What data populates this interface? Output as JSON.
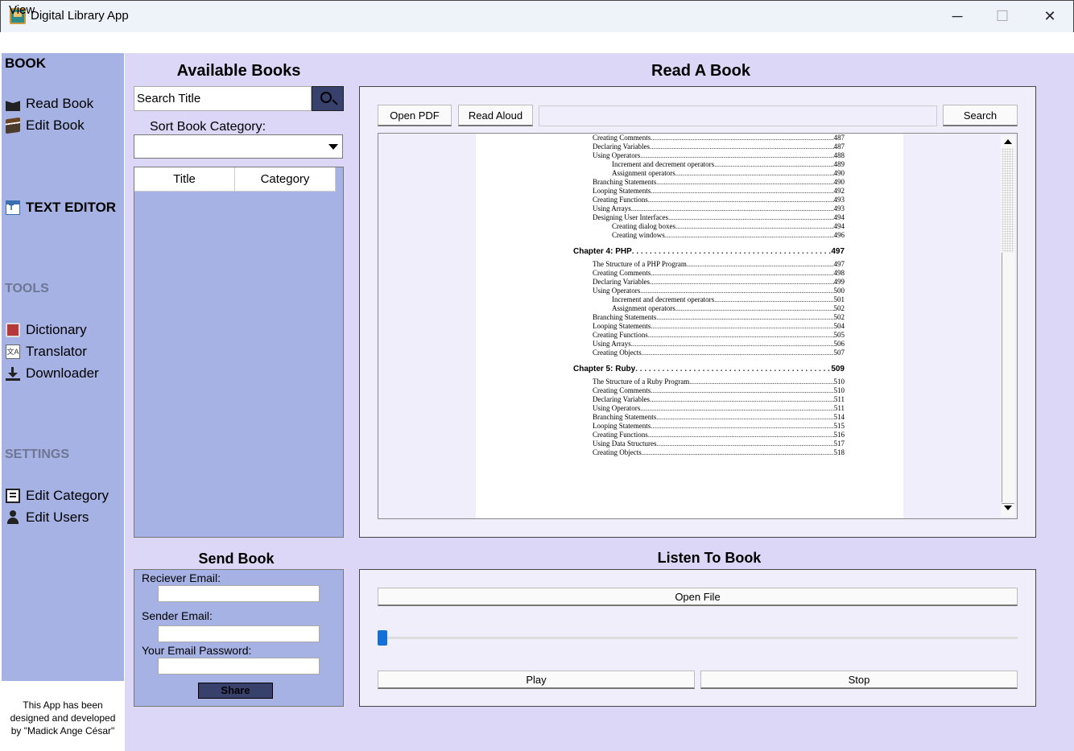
{
  "window": {
    "title": "Digital Library App",
    "minimize": "─",
    "maximize": "☐",
    "close": "✕"
  },
  "menu": {
    "view": "View"
  },
  "sidebar": {
    "book_heading": "BOOK",
    "read_book": "Read Book",
    "edit_book": "Edit Book",
    "text_editor": "TEXT EDITOR",
    "tools_heading": "TOOLS",
    "dictionary": "Dictionary",
    "translator": "Translator",
    "downloader": "Downloader",
    "settings_heading": "SETTINGS",
    "edit_category": "Edit Category",
    "edit_users": "Edit Users",
    "footer_line1": "This App has been",
    "footer_line2": "designed and developed",
    "footer_line3": "by \"Madick Ange César\""
  },
  "available_books": {
    "heading": "Available Books",
    "search_value": "Search Title",
    "sort_label": "Sort Book Category:",
    "sort_value": "",
    "columns": [
      "Title",
      "Category"
    ]
  },
  "reader": {
    "heading": "Read A Book",
    "open_pdf": "Open PDF",
    "read_aloud": "Read Aloud",
    "search_value": "",
    "search_button": "Search",
    "toc": [
      {
        "kind": "item",
        "text": "Creating Comments",
        "page": "487"
      },
      {
        "kind": "item",
        "text": "Declaring Variables",
        "page": "487"
      },
      {
        "kind": "item",
        "text": "Using Operators",
        "page": "488"
      },
      {
        "kind": "sub",
        "text": "Increment and decrement operators",
        "page": "489"
      },
      {
        "kind": "sub",
        "text": "Assignment operators",
        "page": "490"
      },
      {
        "kind": "item",
        "text": "Branching Statements",
        "page": "490"
      },
      {
        "kind": "item",
        "text": "Looping Statements",
        "page": "492"
      },
      {
        "kind": "item",
        "text": "Creating Functions",
        "page": "493"
      },
      {
        "kind": "item",
        "text": "Using Arrays",
        "page": "493"
      },
      {
        "kind": "item",
        "text": "Designing User Interfaces",
        "page": "494"
      },
      {
        "kind": "sub",
        "text": "Creating dialog boxes",
        "page": "494"
      },
      {
        "kind": "sub",
        "text": "Creating windows",
        "page": "496"
      },
      {
        "kind": "chap",
        "text": "Chapter 4: PHP",
        "page": "497"
      },
      {
        "kind": "item",
        "text": "The Structure of a PHP Program",
        "page": "497"
      },
      {
        "kind": "item",
        "text": "Creating Comments",
        "page": "498"
      },
      {
        "kind": "item",
        "text": "Declaring Variables",
        "page": "499"
      },
      {
        "kind": "item",
        "text": "Using Operators",
        "page": "500"
      },
      {
        "kind": "sub",
        "text": "Increment and decrement operators",
        "page": "501"
      },
      {
        "kind": "sub",
        "text": "Assignment operators",
        "page": "502"
      },
      {
        "kind": "item",
        "text": "Branching Statements",
        "page": "502"
      },
      {
        "kind": "item",
        "text": "Looping Statements",
        "page": "504"
      },
      {
        "kind": "item",
        "text": "Creating Functions",
        "page": "505"
      },
      {
        "kind": "item",
        "text": "Using Arrays",
        "page": "506"
      },
      {
        "kind": "item",
        "text": "Creating Objects",
        "page": "507"
      },
      {
        "kind": "chap",
        "text": "Chapter 5: Ruby",
        "page": "509"
      },
      {
        "kind": "item",
        "text": "The Structure of a Ruby Program",
        "page": "510"
      },
      {
        "kind": "item",
        "text": "Creating Comments",
        "page": "510"
      },
      {
        "kind": "item",
        "text": "Declaring Variables",
        "page": "511"
      },
      {
        "kind": "item",
        "text": "Using Operators",
        "page": "511"
      },
      {
        "kind": "item",
        "text": "Branching Statements",
        "page": "514"
      },
      {
        "kind": "item",
        "text": "Looping Statements",
        "page": "515"
      },
      {
        "kind": "item",
        "text": "Creating Functions",
        "page": "516"
      },
      {
        "kind": "item",
        "text": "Using Data Structures",
        "page": "517"
      },
      {
        "kind": "item",
        "text": "Creating Objects",
        "page": "518"
      }
    ]
  },
  "send_book": {
    "heading": "Send Book",
    "receiver_label": "Reciever Email:",
    "receiver_value": "",
    "sender_label": "Sender Email:",
    "sender_value": "",
    "password_label": "Your Email Password:",
    "password_value": "",
    "share": "Share"
  },
  "listen": {
    "heading": "Listen To Book",
    "open_file": "Open File",
    "progress": 0,
    "play": "Play",
    "stop": "Stop"
  },
  "colors": {
    "sidebar_bg": "#a6b2e3",
    "main_bg": "#dcd7f6",
    "panel_bg": "#f1eefb",
    "accent_button": "#38406c",
    "slider_accent": "#1270d8"
  }
}
